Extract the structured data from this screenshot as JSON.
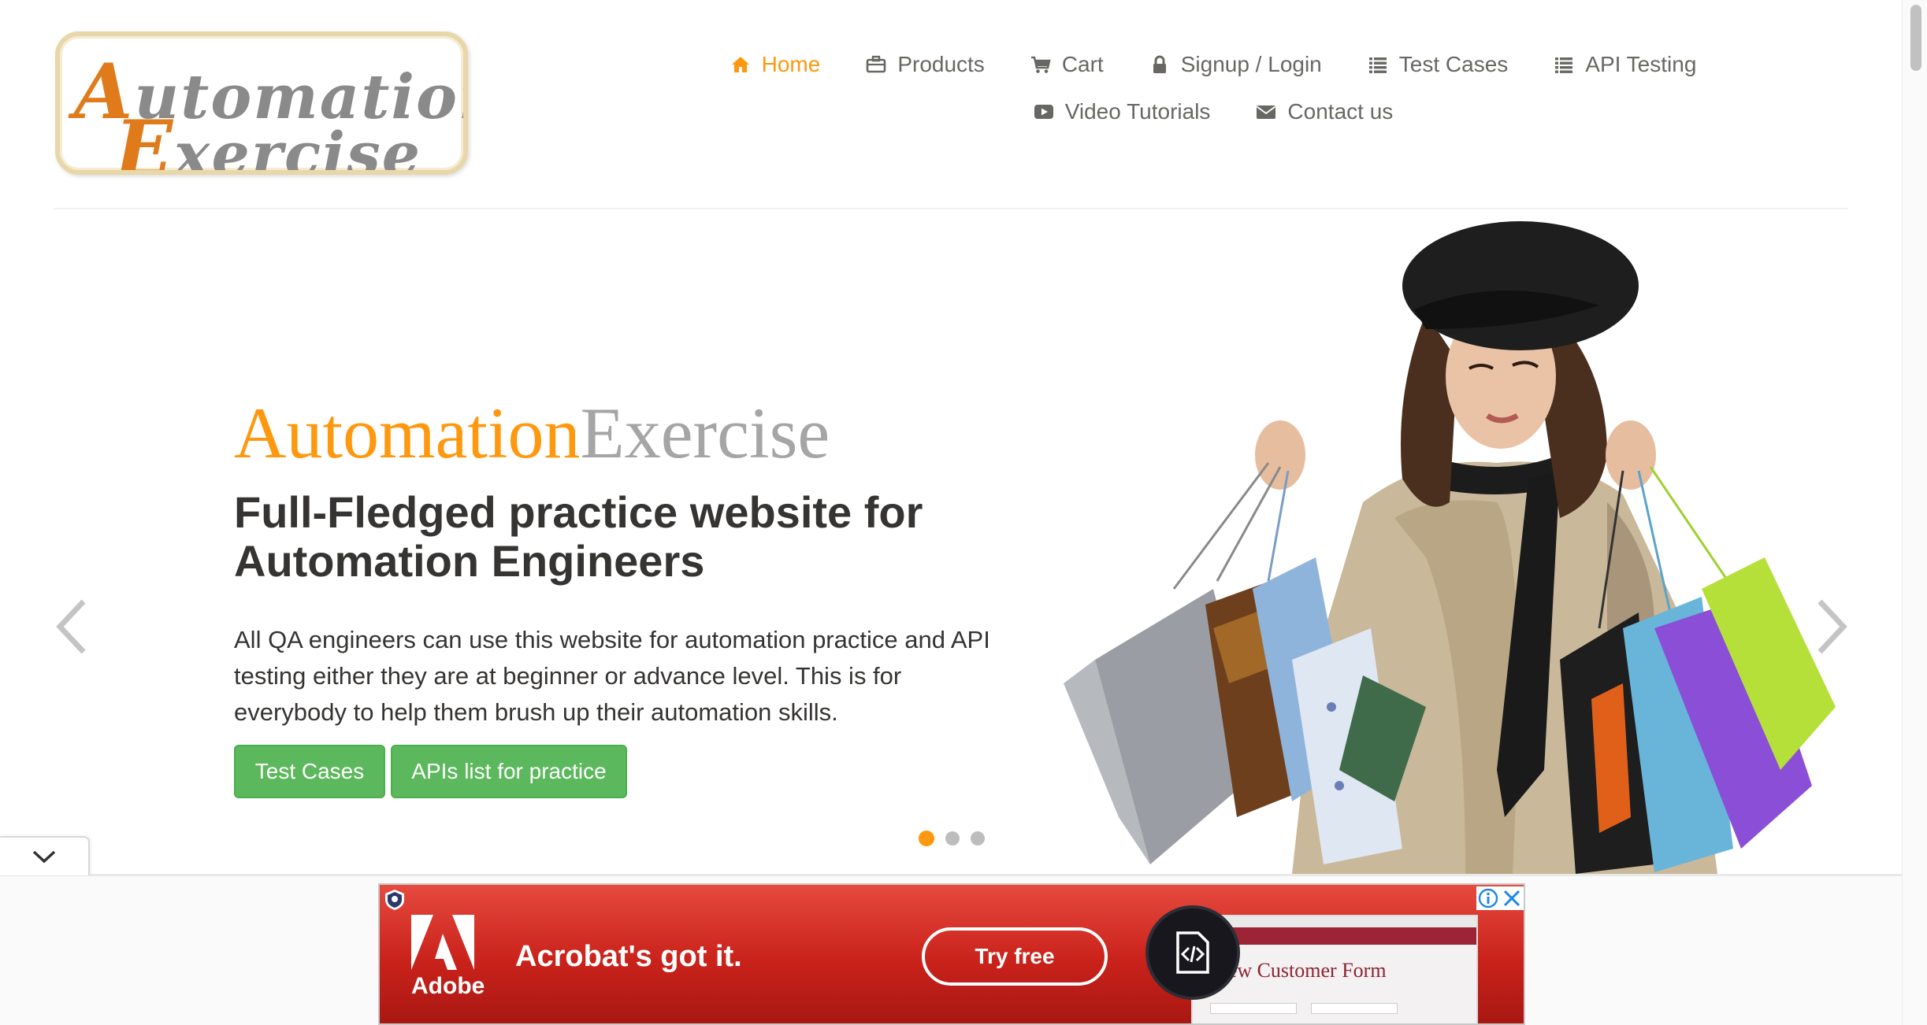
{
  "logo": {
    "line1": "Automation",
    "line2": "Exercise"
  },
  "nav": {
    "row1": [
      {
        "label": "Home",
        "icon": "home-icon",
        "active": true
      },
      {
        "label": "Products",
        "icon": "briefcase-icon"
      },
      {
        "label": "Cart",
        "icon": "cart-icon"
      },
      {
        "label": "Signup / Login",
        "icon": "lock-icon"
      },
      {
        "label": "Test Cases",
        "icon": "list-icon"
      },
      {
        "label": "API Testing",
        "icon": "list-icon"
      }
    ],
    "row2": [
      {
        "label": "Video Tutorials",
        "icon": "youtube-play-icon"
      },
      {
        "label": "Contact us",
        "icon": "envelope-icon"
      }
    ]
  },
  "hero": {
    "title_part1": "Automation",
    "title_part2": "Exercise",
    "subtitle": "Full-Fledged practice website for Automation Engineers",
    "description": "All QA engineers can use this website for automation practice and API testing either they are at beginner or advance level. This is for everybody to help them brush up their automation skills.",
    "btn_test_cases": "Test Cases",
    "btn_apis": "APIs list for practice",
    "active_slide": 1,
    "slide_count": 3
  },
  "ad": {
    "brand": "Adobe",
    "headline": "Acrobat's got it.",
    "cta": "Try free",
    "form_title": "New Customer Form",
    "info_icon": "info-icon",
    "close_icon": "close-icon"
  },
  "colors": {
    "accent": "#fe980f",
    "button_green": "#5cb85c",
    "text_dark": "#363432",
    "text_nav": "#696763"
  }
}
